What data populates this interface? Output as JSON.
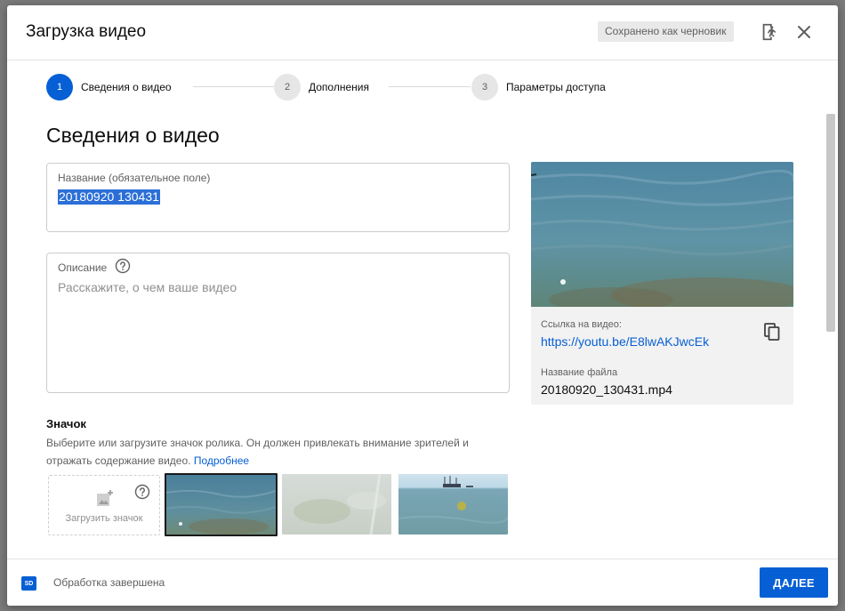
{
  "dialog": {
    "title": "Загрузка видео",
    "draft_status": "Сохранено как черновик",
    "icons": {
      "exit": "exit-icon",
      "close": "close-icon"
    }
  },
  "stepper": {
    "steps": [
      {
        "number": "1",
        "label": "Сведения о видео",
        "active": true
      },
      {
        "number": "2",
        "label": "Дополнения",
        "active": false
      },
      {
        "number": "3",
        "label": "Параметры доступа",
        "active": false
      }
    ]
  },
  "details": {
    "heading": "Сведения о видео",
    "title_field": {
      "label": "Название (обязательное поле)",
      "value": "20180920 130431"
    },
    "description_field": {
      "label": "Описание",
      "placeholder": "Расскажите, о чем ваше видео"
    }
  },
  "thumbnail": {
    "heading": "Значок",
    "description": "Выберите или загрузите значок ролика. Он должен привлекать внимание зрителей и отражать содержание видео.",
    "learn_more": "Подробнее",
    "upload_label": "Загрузить значок"
  },
  "preview": {
    "link_label": "Ссылка на видео:",
    "link": "https://youtu.be/E8lwAKJwcEk",
    "filename_label": "Название файла",
    "filename": "20180920_130431.mp4"
  },
  "footer": {
    "badge": "SD",
    "status": "Обработка завершена",
    "next_button": "ДАЛЕЕ"
  },
  "colors": {
    "accent": "#065fd4",
    "selection": "#2b6fd6"
  }
}
